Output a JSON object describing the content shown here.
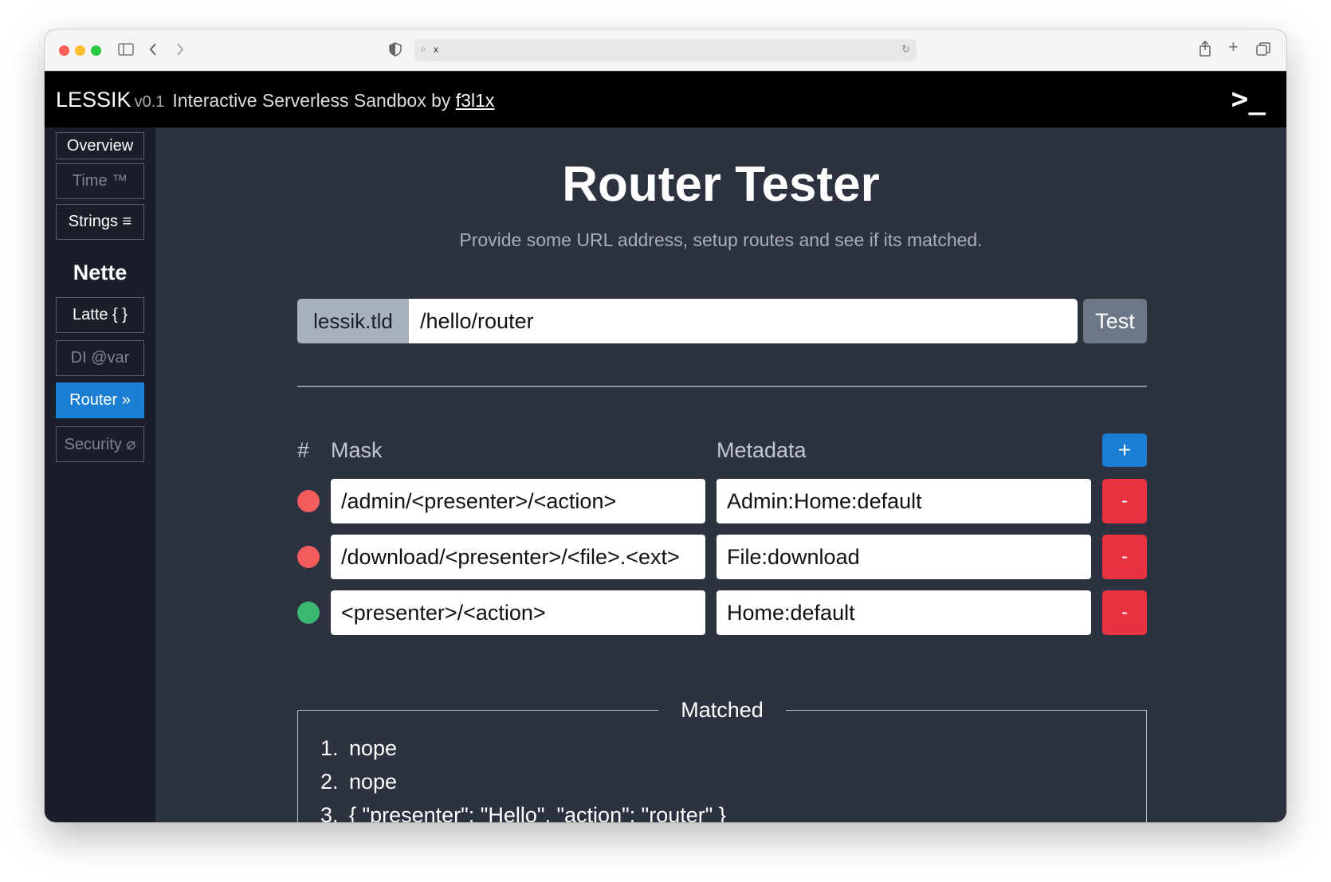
{
  "browser": {
    "address_text": "x"
  },
  "header": {
    "brand": "LESSIK",
    "version": "v0.1",
    "tagline": "Interactive Serverless Sandbox by",
    "author": "f3l1x",
    "terminal_symbol": ">_"
  },
  "sidebar": {
    "items": [
      {
        "label": "Overview",
        "state": "normal"
      },
      {
        "label": "Time ™",
        "state": "dim"
      },
      {
        "label": "Strings ≡",
        "state": "normal"
      }
    ],
    "section_heading": "Nette",
    "section_items": [
      {
        "label": "Latte { }",
        "state": "normal"
      },
      {
        "label": "DI @var",
        "state": "dim"
      },
      {
        "label": "Router »",
        "state": "active"
      },
      {
        "label": "Security ⌀",
        "state": "dim"
      }
    ]
  },
  "main": {
    "title": "Router Tester",
    "subtitle": "Provide some URL address, setup routes and see if its matched.",
    "url": {
      "prefix": "lessik.tld",
      "value": "/hello/router",
      "test_label": "Test"
    },
    "table": {
      "col_hash": "#",
      "col_mask": "Mask",
      "col_metadata": "Metadata",
      "add_label": "+",
      "remove_label": "-",
      "routes": [
        {
          "mask": "/admin/<presenter>/<action>",
          "metadata": "Admin:Home:default",
          "matched": false
        },
        {
          "mask": "/download/<presenter>/<file>.<ext>",
          "metadata": "File:download",
          "matched": false
        },
        {
          "mask": "<presenter>/<action>",
          "metadata": "Home:default",
          "matched": true
        }
      ]
    },
    "matched": {
      "legend": "Matched",
      "results": [
        {
          "num": "1.",
          "text": "nope"
        },
        {
          "num": "2.",
          "text": "nope"
        },
        {
          "num": "3.",
          "text": "{ \"presenter\": \"Hello\", \"action\": \"router\" }"
        }
      ]
    }
  },
  "colors": {
    "active_nav": "#1a7fd4",
    "add_button": "#1a7fd4",
    "remove_button": "#e8323f",
    "no_match": "#f25c5c",
    "match": "#3cb872",
    "test_button": "#6c7787"
  }
}
